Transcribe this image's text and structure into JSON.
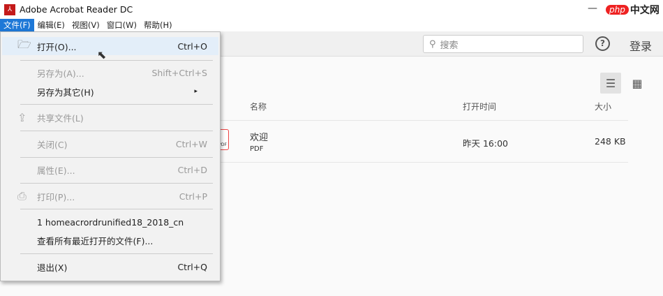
{
  "app": {
    "title": "Adobe Acrobat Reader DC",
    "watermark": "php中文网"
  },
  "menubar": [
    "文件(F)",
    "编辑(E)",
    "视图(V)",
    "窗口(W)",
    "帮助(H)"
  ],
  "toolbar": {
    "search_placeholder": "搜索",
    "help": "?",
    "login": "登录"
  },
  "table": {
    "headers": [
      "名称",
      "打开时间",
      "大小"
    ],
    "rows": [
      {
        "name": "欢迎",
        "type": "PDF",
        "opened": "昨天 16:00",
        "size": "248 KB"
      }
    ]
  },
  "file_menu": [
    {
      "label": "打开(O)...",
      "shortcut": "Ctrl+O"
    },
    {
      "label": "另存为(A)...",
      "shortcut": "Shift+Ctrl+S"
    },
    {
      "label": "另存为其它(H)",
      "shortcut": "▸"
    },
    {
      "label": "共享文件(L)",
      "shortcut": ""
    },
    {
      "label": "关闭(C)",
      "shortcut": "Ctrl+W"
    },
    {
      "label": "属性(E)...",
      "shortcut": "Ctrl+D"
    },
    {
      "label": "打印(P)...",
      "shortcut": "Ctrl+P"
    },
    {
      "label": "1 homeacrordrunified18_2018_cn",
      "shortcut": ""
    },
    {
      "label": "查看所有最近打开的文件(F)...",
      "shortcut": ""
    },
    {
      "label": "退出(X)",
      "shortcut": "Ctrl+Q"
    }
  ]
}
